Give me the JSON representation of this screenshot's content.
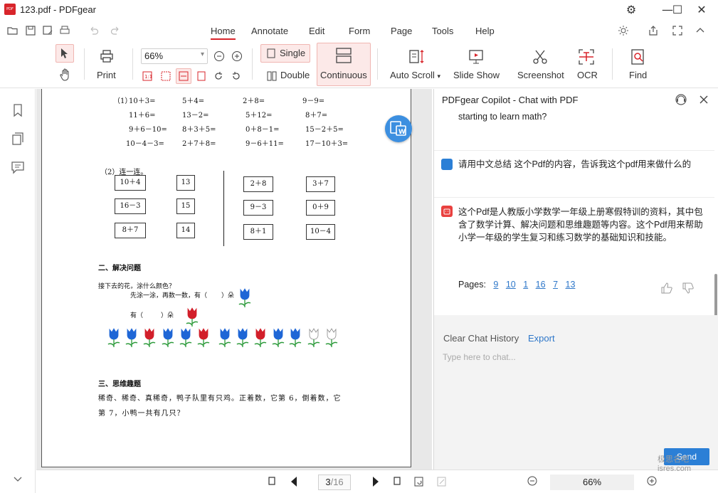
{
  "app": {
    "logo_text": "PDF",
    "title": "123.pdf - PDFgear"
  },
  "menu": {
    "tabs": [
      "Home",
      "Annotate",
      "Edit",
      "Form",
      "Page",
      "Tools",
      "Help"
    ],
    "active": "Home"
  },
  "ribbon": {
    "print": "Print",
    "zoom": "66%",
    "single": "Single",
    "double": "Double",
    "continuous": "Continuous",
    "auto_scroll": "Auto Scroll",
    "slide_show": "Slide Show",
    "screenshot": "Screenshot",
    "ocr": "OCR",
    "find": "Find"
  },
  "document": {
    "q1_label": "（1）",
    "equations": [
      [
        "10＋3=",
        "5＋4=",
        "2＋8=",
        "9－9="
      ],
      [
        "11＋6=",
        "13－2=",
        "5＋12=",
        "8＋7="
      ],
      [
        "9＋6－10=",
        "8＋3＋5=",
        "0＋8－1=",
        "15－2＋5="
      ],
      [
        "10－4－3=",
        "2＋7＋8=",
        "9－6＋11=",
        "17－10＋3="
      ]
    ],
    "q2_label": "（2）连一连。",
    "left_boxes": [
      "10＋4",
      "16－3",
      "8＋7"
    ],
    "left_answers": [
      "13",
      "15",
      "14"
    ],
    "right_boxes": [
      "2＋8",
      "9－3",
      "8＋1"
    ],
    "right_answers": [
      "3＋7",
      "0＋9",
      "10－4"
    ],
    "section2_title": "二、解决问题",
    "section2_q": "接下去的花，涂什么颜色？",
    "section2_line1_a": "先涂一涂，再数一数，有（",
    "section2_line1_b": "）朵",
    "section2_line2_a": "有（",
    "section2_line2_b": "）朵",
    "section3_title": "三、思维趣题",
    "section3_line1": "稀奇、稀奇、真稀奇，鸭子队里有只鸡。正着数，它第 6，倒着数，它",
    "section3_line2": "第 7，小鸭一共有几只？"
  },
  "status": {
    "page_current": "3",
    "page_total": "/16",
    "zoom": "66%"
  },
  "chat": {
    "title": "PDFgear Copilot - Chat with PDF",
    "prev_tail": "starting to learn math?",
    "user_msg": "请用中文总结 这个Pdf的内容，告诉我这个pdf用来做什么的",
    "ai_msg_lines": [
      "这个Pdf是人教版小学数学一年级上册寒假特训的资料，其中包",
      "含了数学计算、解决问题和思维趣题等内容。这个Pdf用来帮助",
      "小学一年级的学生复习和练习数学的基础知识和技能。"
    ],
    "pages_label": "Pages:",
    "pages": [
      "9",
      "10",
      "1",
      "16",
      "7",
      "13"
    ],
    "clear_history": "Clear Chat History",
    "export": "Export",
    "input_placeholder": "Type here to chat...",
    "send": "Send"
  },
  "watermark": {
    "line1": "极思名吧",
    "line2": "isres.com"
  },
  "colors": {
    "accent_red": "#d8252b",
    "link_blue": "#2e77c9",
    "send_blue": "#2b7fd6",
    "fab_blue": "#3c8fe0",
    "highlight_bg": "#fce9e8"
  }
}
